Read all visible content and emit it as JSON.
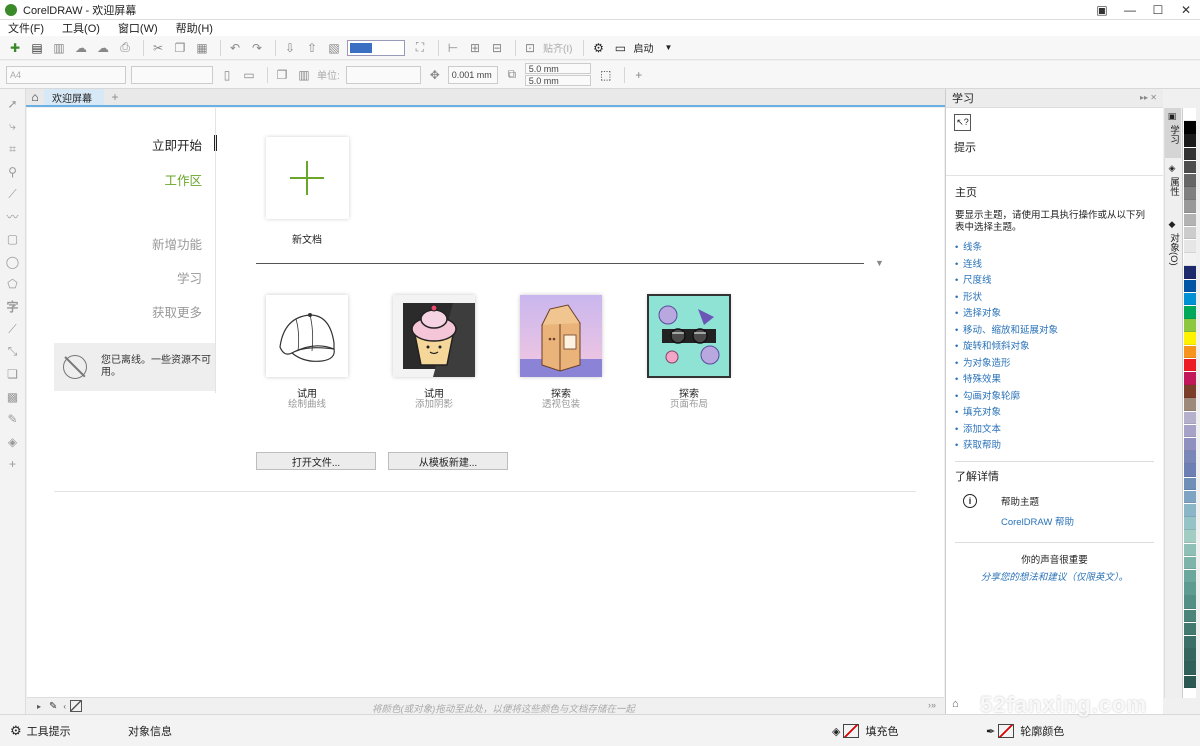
{
  "window": {
    "title": "CorelDRAW - 欢迎屏幕"
  },
  "menu": [
    "文件(F)",
    "工具(O)",
    "窗口(W)",
    "帮助(H)"
  ],
  "toolbar": {
    "start_label": "启动",
    "paste_label": "贴齐(I)",
    "paper_size": "A4",
    "units_label": "单位:",
    "nudge_value": "0.001 mm",
    "dup_x": "5.0 mm",
    "dup_y": "5.0 mm"
  },
  "tabs": {
    "welcome_tab": "欢迎屏幕"
  },
  "nav": {
    "items": [
      "立即开始",
      "工作区",
      "新增功能",
      "学习",
      "获取更多"
    ],
    "offline_message": "您已离线。一些资源不可用。"
  },
  "welcome": {
    "new_doc_label": "新文档",
    "cards": [
      {
        "title": "试用",
        "subtitle": "绘制曲线"
      },
      {
        "title": "试用",
        "subtitle": "添加阴影"
      },
      {
        "title": "探索",
        "subtitle": "透视包装"
      },
      {
        "title": "探索",
        "subtitle": "页面布局"
      }
    ],
    "open_file_button": "打开文件...",
    "from_template_button": "从模板新建...",
    "palette_hint": "将颜色(或对象)拖动至此处，以便将这些颜色与文档存储在一起"
  },
  "docker": {
    "header": "学习",
    "hint_title": "提示",
    "home_title": "主页",
    "home_body": "要显示主题，请使用工具执行操作或从以下列表中选择主题。",
    "links": [
      "线条",
      "连线",
      "尺度线",
      "形状",
      "选择对象",
      "移动、缩放和延展对象",
      "旋转和倾斜对象",
      "为对象造形",
      "特殊效果",
      "勾画对象轮廓",
      "填充对象",
      "添加文本",
      "获取帮助"
    ],
    "learn_more_title": "了解详情",
    "help_topic_title": "帮助主题",
    "help_link": "CorelDRAW 帮助",
    "feedback_title": "你的声音很重要",
    "feedback_link": "分享您的想法和建议（仅限英文）。"
  },
  "side_tabs": [
    "学习",
    "属性",
    "对象(O)"
  ],
  "palette_colors": [
    "#ffffff",
    "#000000",
    "#1a1a1a",
    "#333333",
    "#4d4d4d",
    "#666666",
    "#808080",
    "#999999",
    "#b3b3b3",
    "#cccccc",
    "#e6e6e6",
    "#f2f2f2",
    "#1d2a6b",
    "#0055a5",
    "#0091d5",
    "#00a859",
    "#8dc63f",
    "#fff200",
    "#f7941d",
    "#ed1c24",
    "#c2185b",
    "#7a3e2a",
    "#9e8a7a",
    "#b5b0cc",
    "#a7a3c8",
    "#8f8fc0",
    "#7b86b8",
    "#6d7fb3",
    "#6e8fb8",
    "#7fa3c2",
    "#8ab6c7",
    "#96c4c6",
    "#a3cdc2",
    "#8fc0b5",
    "#7cb4a9",
    "#6ba79c",
    "#5e9b90",
    "#538f85",
    "#4a847a",
    "#427a70",
    "#3b7068",
    "#35675f",
    "#306057",
    "#2b5850"
  ],
  "statusbar": {
    "tool_hints": "工具提示",
    "object_info": "对象信息",
    "fill_label": "填充色",
    "outline_label": "轮廓颜色"
  },
  "watermark": "52fanxing.com"
}
